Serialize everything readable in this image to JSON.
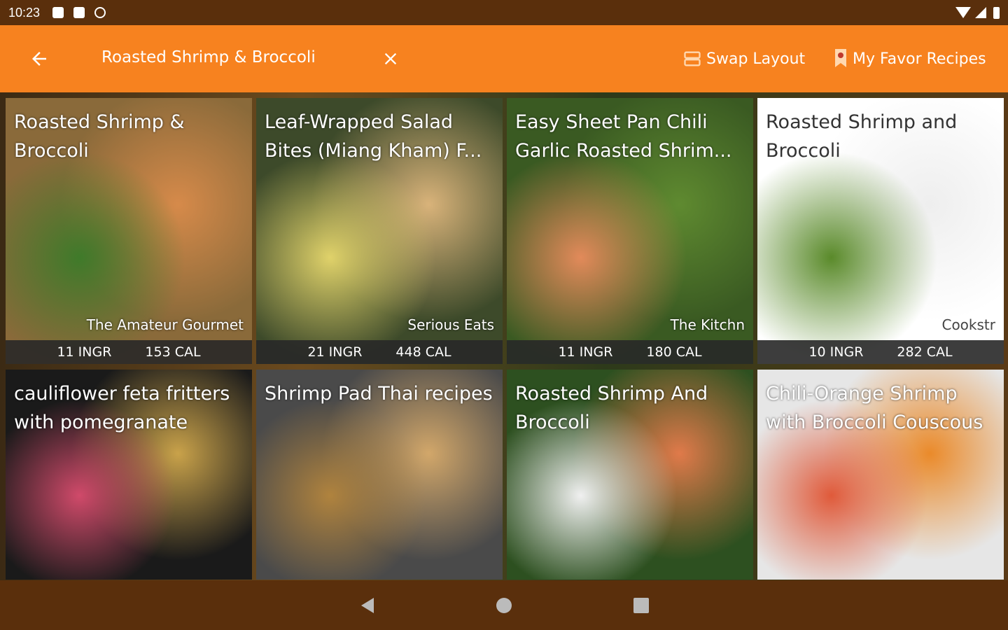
{
  "status": {
    "time": "10:23"
  },
  "appbar": {
    "title": "Roasted Shrimp & Broccoli",
    "swap_label": "Swap Layout",
    "fav_label": "My Favor Recipes"
  },
  "recipes": [
    {
      "title": "Roasted Shrimp & Broccoli",
      "source": "The Amateur Gourmet",
      "ingr": "11 INGR",
      "cal": "153 CAL",
      "colors": [
        "#8a6a3a",
        "#d68a4a",
        "#3f7a2a"
      ]
    },
    {
      "title": "Leaf-Wrapped Salad Bites (Miang Kham) F...",
      "source": "Serious Eats",
      "ingr": "21 INGR",
      "cal": "448 CAL",
      "colors": [
        "#3d4a2a",
        "#d9b37a",
        "#e0d26a"
      ]
    },
    {
      "title": "Easy Sheet Pan Chili Garlic Roasted Shrim...",
      "source": "The Kitchn",
      "ingr": "11 INGR",
      "cal": "180 CAL",
      "colors": [
        "#3a5a22",
        "#5f8a30",
        "#e28a5a"
      ]
    },
    {
      "title": "Roasted Shrimp and Broccoli",
      "source": "Cookstr",
      "ingr": "10 INGR",
      "cal": "282 CAL",
      "colors": [
        "#ffffff",
        "#eeeeee",
        "#5a8a2a"
      ]
    },
    {
      "title": "cauliflower feta fritters with pomegranate",
      "source": "",
      "ingr": "",
      "cal": "",
      "colors": [
        "#1a1a1a",
        "#c9a24a",
        "#d04a6a"
      ]
    },
    {
      "title": "Shrimp Pad Thai recipes",
      "source": "",
      "ingr": "",
      "cal": "",
      "colors": [
        "#4a4a4a",
        "#d2a76a",
        "#b0833e"
      ]
    },
    {
      "title": "Roasted Shrimp And Broccoli",
      "source": "",
      "ingr": "",
      "cal": "",
      "colors": [
        "#2d5020",
        "#e07a4a",
        "#f0f0f0"
      ]
    },
    {
      "title": "Chili-Orange Shrimp with Broccoli Couscous",
      "source": "",
      "ingr": "",
      "cal": "",
      "colors": [
        "#e6e6e6",
        "#ea8a2a",
        "#e05a3a"
      ]
    }
  ]
}
